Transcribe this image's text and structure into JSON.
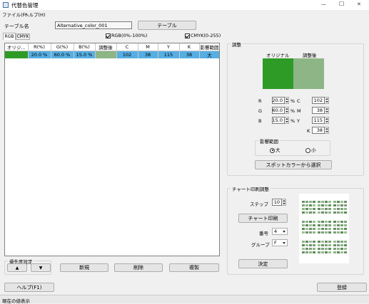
{
  "window": {
    "title": "代替色管理"
  },
  "titlebar": {
    "minimize": "—",
    "maximize": "☐",
    "close": "✕"
  },
  "menu": {
    "file": "ファイル(F)",
    "help": "ヘルプ(H)"
  },
  "table_name": {
    "label": "テーブル名",
    "value": "Alternative_color_001",
    "button": "テーブル"
  },
  "tabs": {
    "rgb": "RGB",
    "cmyk": "CMYK"
  },
  "checks": {
    "rgb": "RGB(0%-100%)",
    "cmyk": "CMYK(0-255)"
  },
  "grid": {
    "headers": [
      "オリジ...",
      "R(%)",
      "G(%)",
      "B(%)",
      "調整後",
      "C",
      "M",
      "Y",
      "K",
      "影響範囲"
    ],
    "rows": [
      {
        "r": "20.0 %",
        "g": "60.0 %",
        "b": "15.0 %",
        "c": "102",
        "m": "38",
        "y": "115",
        "k": "38",
        "range": "大"
      }
    ]
  },
  "adjust": {
    "title": "調整",
    "original_label": "オリジナル",
    "adjusted_label": "調整後",
    "original_color": "#2e9b26",
    "adjusted_color": "#8db585",
    "r_label": "R",
    "r_value": "20.0",
    "g_label": "G",
    "g_value": "60.0",
    "b_label": "B",
    "b_value": "15.0",
    "unit": "%",
    "c_label": "C",
    "c_value": "102",
    "m_label": "M",
    "m_value": "38",
    "y_label": "Y",
    "y_value": "115",
    "k_label": "K",
    "k_value": "38",
    "range_title": "影響範囲",
    "range_large": "大",
    "range_small": "小",
    "spot_button": "スポットカラーから選択"
  },
  "chart": {
    "title": "チャート印刷調整",
    "step_label": "ステップ",
    "step_value": "10",
    "print_button": "チャート印刷",
    "number_label": "番号",
    "number_value": "4",
    "group_label": "グループ",
    "group_value": "F",
    "decide_button": "決定"
  },
  "priority": {
    "title": "優先度設定",
    "up": "▲",
    "down": "▼"
  },
  "actions": {
    "new": "新規",
    "delete": "削除",
    "copy": "複製"
  },
  "footer": {
    "help": "ヘルプ(F1)",
    "register": "登録"
  },
  "status": {
    "text": "現在の値表示"
  }
}
